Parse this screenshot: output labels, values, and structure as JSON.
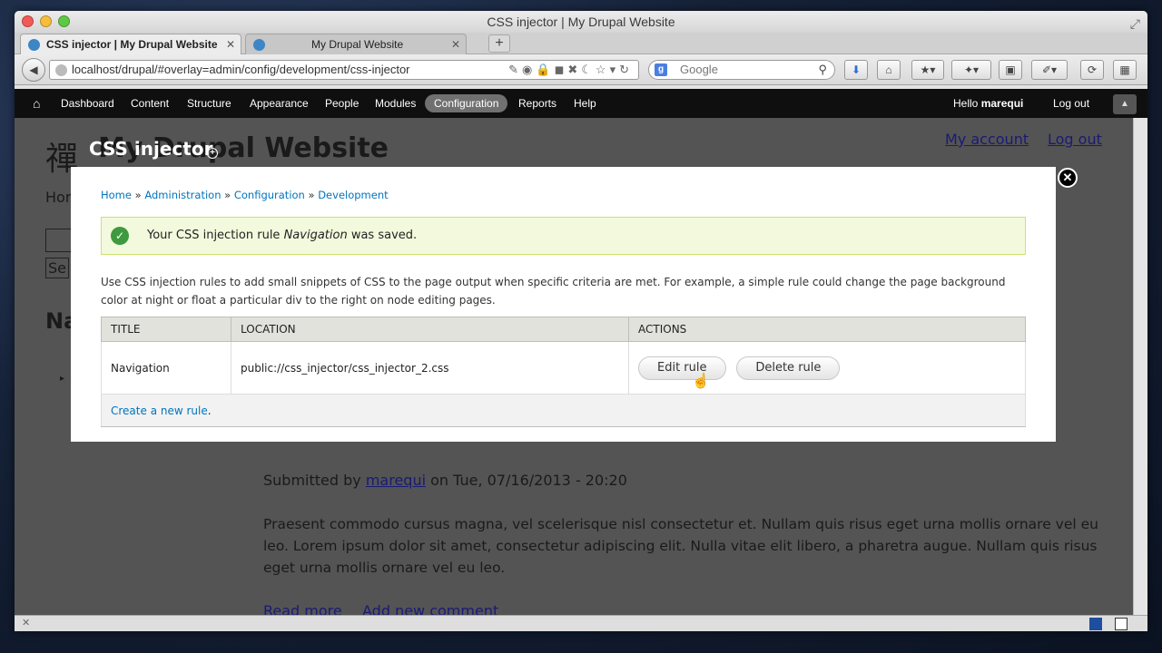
{
  "window": {
    "title": "CSS injector | My Drupal Website"
  },
  "tabs": [
    {
      "label": "CSS injector | My Drupal Website",
      "active": true
    },
    {
      "label": "My Drupal Website",
      "active": false
    }
  ],
  "navbar": {
    "url": "localhost/drupal/#overlay=admin/config/development/css-injector",
    "search_placeholder": "Google"
  },
  "admin_menu": {
    "items": [
      "Dashboard",
      "Content",
      "Structure",
      "Appearance",
      "People",
      "Modules",
      "Configuration",
      "Reports",
      "Help"
    ],
    "active": "Configuration",
    "greeting": "Hello ",
    "username": "marequi",
    "logout": "Log out"
  },
  "background_page": {
    "site_name": "My Drupal Website",
    "logo_char": "禪",
    "my_account": "My account",
    "logout": "Log out",
    "home_fragment": "Hor",
    "search_fragment": "Se",
    "heading_fragment": "Na",
    "submitted_prefix": "Submitted by ",
    "author": "marequi",
    "submitted_suffix": " on Tue, 07/16/2013 - 20:20",
    "body": "Praesent commodo cursus magna, vel scelerisque nisl consectetur et. Nullam quis risus eget urna mollis ornare vel eu leo. Lorem ipsum dolor sit amet, consectetur adipiscing elit. Nulla vitae elit libero, a pharetra augue. Nullam quis risus eget urna mollis ornare vel eu leo.",
    "read_more": "Read more",
    "add_comment": "Add new comment"
  },
  "overlay": {
    "title": "CSS injector",
    "breadcrumb": [
      "Home",
      "Administration",
      "Configuration",
      "Development"
    ],
    "message_prefix": "Your CSS injection rule ",
    "message_rule": "Navigation",
    "message_suffix": " was saved.",
    "intro": "Use CSS injection rules to add small snippets of CSS to the page output when specific criteria are met. For example, a simple rule could change the page background color at night or float a particular div to the right on node editing pages.",
    "table": {
      "headers": [
        "Title",
        "Location",
        "Actions"
      ],
      "rows": [
        {
          "title": "Navigation",
          "location": "public://css_injector/css_injector_2.css",
          "edit": "Edit rule",
          "delete": "Delete rule"
        }
      ],
      "create_link": "Create a new rule"
    }
  }
}
